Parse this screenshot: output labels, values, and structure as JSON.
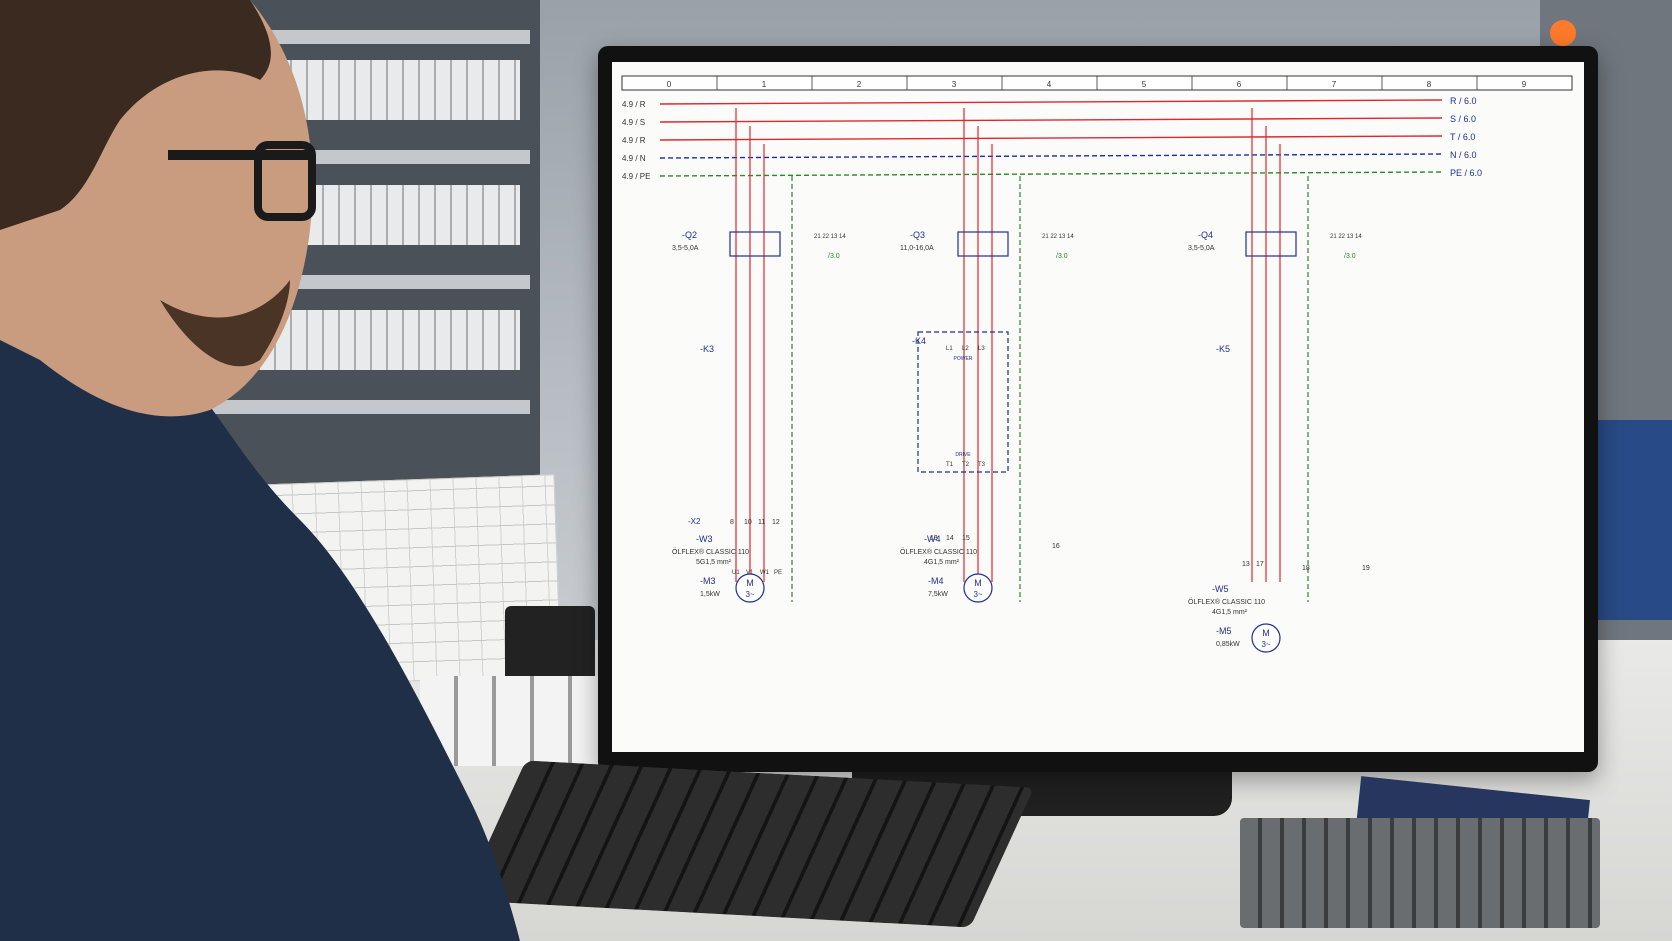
{
  "scene": {
    "description_colors": {
      "red_line": "#e2272c",
      "blue_dashed": "#1c2fa8",
      "green_dashed": "#2c8a2c",
      "symbol_blue": "#1f2f8f"
    }
  },
  "schematic": {
    "columns": [
      "0",
      "1",
      "2",
      "3",
      "4",
      "5",
      "6",
      "7",
      "8",
      "9"
    ],
    "bus_left": [
      "4.9 / R",
      "4.9 / S",
      "4.9 / R",
      "4.9 / N",
      "4.9 / PE"
    ],
    "bus_right": [
      "R / 6.0",
      "S / 6.0",
      "T / 6.0",
      "N / 6.0",
      "PE / 6.0"
    ],
    "breakers": [
      {
        "tag": "-Q2",
        "rating": "3,5-5,0A",
        "aux": [
          "21",
          "22",
          "13",
          "14"
        ],
        "aux_ref": "/3.0"
      },
      {
        "tag": "-Q3",
        "rating": "11,0-16,0A",
        "aux": [
          "21",
          "22",
          "13",
          "14"
        ],
        "aux_ref": "/3.0"
      },
      {
        "tag": "-Q4",
        "rating": "3,5-5,0A",
        "aux": [
          "21",
          "22",
          "13",
          "14"
        ],
        "aux_ref": "/3.0"
      }
    ],
    "contactors": [
      "-K3",
      "-K4",
      "-K5"
    ],
    "drive": {
      "top_label": "POWER",
      "bottom_label": "DRIVE",
      "terms_top": [
        "L1",
        "L2",
        "L3"
      ],
      "terms_bottom": [
        "T1",
        "T2",
        "T3"
      ]
    },
    "terminals": {
      "x2": "-X2",
      "x2_nums": [
        "8",
        "10",
        "11",
        "12"
      ],
      "w4_nums": [
        "13",
        "14",
        "15"
      ],
      "w4_pe": "16",
      "w5_nums": [
        "13",
        "17"
      ],
      "w5_extra": [
        "18",
        "19"
      ]
    },
    "cables": [
      {
        "tag": "-W3",
        "type": "ÖLFLEX® CLASSIC 110",
        "size": "5G1,5 mm²"
      },
      {
        "tag": "-W4",
        "type": "ÖLFLEX® CLASSIC 110",
        "size": "4G1,5 mm²"
      },
      {
        "tag": "-W5",
        "type": "ÖLFLEX® CLASSIC 110",
        "size": "4G1,5 mm²"
      }
    ],
    "motors": [
      {
        "tag": "-M3",
        "power": "1,5kW",
        "symbol": "M",
        "phase": "3~"
      },
      {
        "tag": "-M4",
        "power": "7,5kW",
        "symbol": "M",
        "phase": "3~"
      },
      {
        "tag": "-M5",
        "power": "0,85kW",
        "symbol": "M",
        "phase": "3~"
      }
    ],
    "motor_terms": [
      "U1",
      "V1",
      "W1",
      "PE"
    ]
  },
  "icons": [
    "person",
    "monitor",
    "keyboard",
    "pen-cup",
    "terminal-blocks",
    "notebook",
    "drawing-sheet",
    "control-cabinet"
  ]
}
